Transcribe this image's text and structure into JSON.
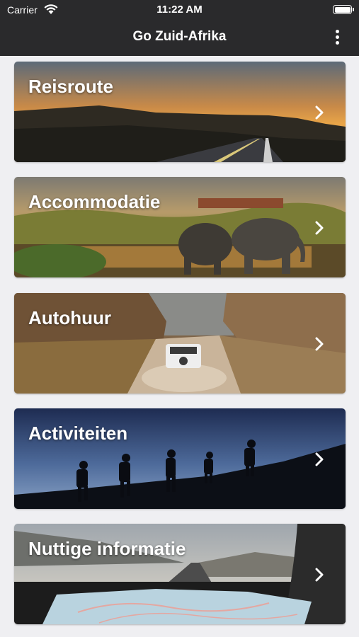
{
  "status_bar": {
    "carrier": "Carrier",
    "time": "11:22 AM"
  },
  "nav_bar": {
    "title": "Go Zuid-Afrika"
  },
  "menu": [
    {
      "label": "Reisroute"
    },
    {
      "label": "Accommodatie"
    },
    {
      "label": "Autohuur"
    },
    {
      "label": "Activiteiten"
    },
    {
      "label": "Nuttige informatie"
    }
  ]
}
